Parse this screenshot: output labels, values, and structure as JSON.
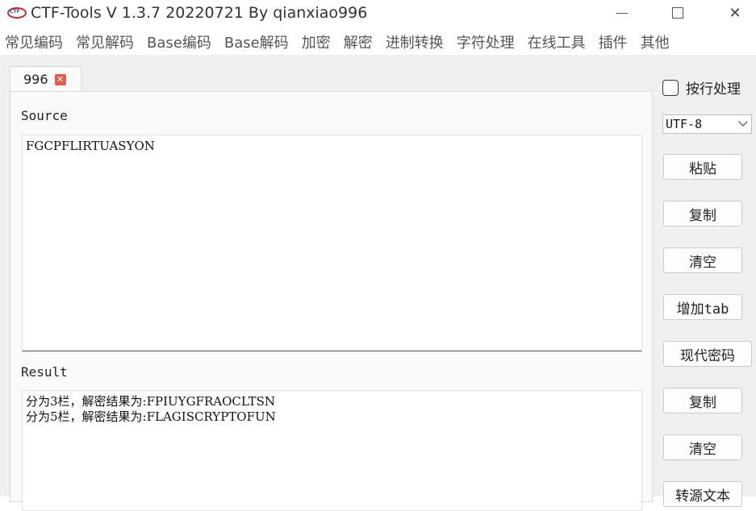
{
  "window": {
    "title": "CTF-Tools V 1.3.7 20220721 By qianxiao996"
  },
  "menu": [
    "常见编码",
    "常见解码",
    "Base编码",
    "Base解码",
    "加密",
    "解密",
    "进制转换",
    "字符处理",
    "在线工具",
    "插件",
    "其他"
  ],
  "tab": {
    "label": "996"
  },
  "source": {
    "label": "Source",
    "value": "FGCPFLIRTUASYON"
  },
  "result": {
    "label": "Result",
    "value": "分为3栏，解密结果为:FPIUYGFRAOCLTSN\n分为5栏，解密结果为:FLAGISCRYPTOFUN"
  },
  "sidebar": {
    "line_mode_label": "按行处理",
    "line_mode_checked": false,
    "encoding": "UTF-8",
    "buttons": {
      "paste": "粘贴",
      "copy_source": "复制",
      "clear_source": "清空",
      "add_tab": "增加tab",
      "modern_cipher": "现代密码",
      "copy_result": "复制",
      "clear_result": "清空",
      "transfer_text": "转源文本"
    }
  },
  "colors": {
    "tab_close": "#e35d4e",
    "app_logo_ring": "#c8282a",
    "app_logo_text": "#1a5fb4"
  }
}
